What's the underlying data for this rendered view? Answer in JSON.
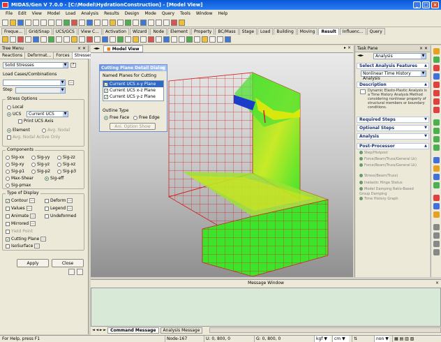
{
  "window": {
    "title": "MIDAS/Gen V 7.0.0 - [C:\\Model\\HydrationConstruction] - [Model View]"
  },
  "menu": [
    "File",
    "Edit",
    "View",
    "Model",
    "Load",
    "Analysis",
    "Results",
    "Design",
    "Mode",
    "Query",
    "Tools",
    "Window",
    "Help"
  ],
  "ribbon_tabs": [
    "Freque...",
    "Grid/Snap",
    "UCS/GCS",
    "View C...",
    "Activation",
    "Wizard",
    "Node",
    "Element",
    "Property",
    "BC/Mass",
    "Stage",
    "Load",
    "Building",
    "Moving",
    "Result",
    "Influenc...",
    "Query"
  ],
  "active_ribbon_tab": "Result",
  "tree": {
    "title": "Tree Menu",
    "tabs": [
      "Reactions",
      "Deformat...",
      "Forces",
      "Stresses"
    ],
    "active_tab": "Stresses",
    "result_type": "Solid Stresses",
    "load_cases_label": "Load Cases/Combinations",
    "step_label": "Step",
    "stress_options_label": "Stress Options",
    "local_label": "Local",
    "ucs_label": "UCS",
    "ucs_value": "Current UCS",
    "print_ucs_label": "Print UCS Axis",
    "element_label": "Element",
    "avg_nodal_label": "Avg. Nodal",
    "avg_nodal_active_label": "Avg. Nodal Active Only",
    "components_label": "Components",
    "components": [
      "Sig-xx",
      "Sig-yy",
      "Sig-zz",
      "Sig-xy",
      "Sig-yz",
      "Sig-xz",
      "Sig-p1",
      "Sig-p2",
      "Sig-p3",
      "Max-Shear",
      "Sig-eff",
      "Sig-pmax"
    ],
    "selected_component": "Sig-eff",
    "display_label": "Type of Display",
    "display_items": [
      "Contour",
      "Deform",
      "Values",
      "Legend",
      "Animate",
      "Undeformed",
      "Mirrored",
      "Yield Point",
      "Cutting Plane",
      "IsoSurface"
    ],
    "checked_display": [
      "Contour",
      "Cutting Plane"
    ],
    "apply_label": "Apply",
    "close_label": "Close"
  },
  "viewport": {
    "tab": "Model View"
  },
  "cutting_dialog": {
    "title": "Cutting Plane Detail Dialog",
    "planes_label": "Named Planes for Cutting",
    "planes": [
      "Current UCS x-y Plane",
      "Current UCS x-z Plane",
      "Current UCS y-z Plane"
    ],
    "outline_label": "Outline Type",
    "free_face_label": "Free Face",
    "free_edge_label": "Free Edge",
    "option_label": "Ani. Option Show"
  },
  "task_pane": {
    "title": "Task Pane",
    "dropdown": "Analysis",
    "select_features_label": "Select Analysis Features",
    "feature_value": "Nonlinear Time History Analysis",
    "description_label": "Description",
    "description_text": "Dynamic Elasto-Plastic Analysis is a Time History Analysis Method considering nonlinear property of structural members or boundary conditions.",
    "sections": [
      "Required Steps",
      "Optional Steps",
      "Analysis",
      "Post-Processor"
    ],
    "post_items": [
      "Step/Histpost",
      "Force(Beam/Truss/General Lk)",
      "Force(Beam/Truss/General Lk)",
      "Stress(Beam/Truss)",
      "Inelastic Hinge Status",
      "Model Damping Ratio-Based Group Damping",
      "Time History Graph"
    ]
  },
  "message_window": {
    "title": "Message Window",
    "tabs": [
      "Command Message",
      "Analysis Message"
    ],
    "active_tab": "Command Message"
  },
  "status": {
    "help": "For Help, press F1",
    "node": "Node-167",
    "u": "U: 0, 800, 0",
    "g": "G: 0, 800, 0",
    "force_unit": "kgf",
    "length_unit": "cm",
    "extra": "non"
  },
  "colors": {
    "accent": "#0a58d8",
    "mesh": "#d02020",
    "contour_green": "#3ee42c",
    "contour_yellow": "#e4e80a",
    "contour_blue": "#1b3cc8"
  }
}
